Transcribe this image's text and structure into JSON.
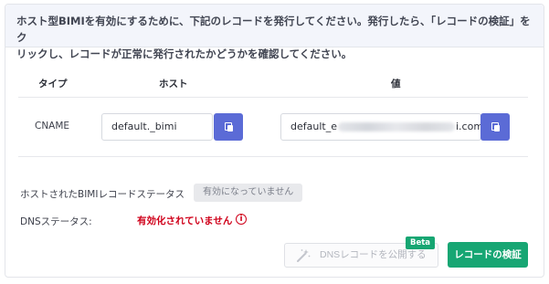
{
  "notice": {
    "line1": "ホスト型BIMIを有効にするために、下記のレコードを発行してください。発行したら、「レコードの検証」をク",
    "line2": "リックし、レコードが正常に発行されたかどうかを確認してください。"
  },
  "table": {
    "headers": {
      "type": "タイプ",
      "host": "ホスト",
      "value": "値"
    },
    "row": {
      "type": "CNAME",
      "host": "default._bimi",
      "value_prefix": "default_e",
      "value_suffix": "i.com"
    }
  },
  "status": {
    "bimi_label": "ホストされたBIMIレコードステータス",
    "bimi_value": "有効になっていません",
    "dns_label": "DNSステータス:",
    "dns_value": "有効化されていません",
    "dns_color": "#d0021b"
  },
  "actions": {
    "publish_label": "DNSレコードを公開する",
    "beta_label": "Beta",
    "verify_label": "レコードの検証",
    "primary_color": "#17a673"
  },
  "icons": {
    "copy": "copy-icon",
    "warning": "info-warning-icon",
    "wand": "magic-wand-icon"
  }
}
